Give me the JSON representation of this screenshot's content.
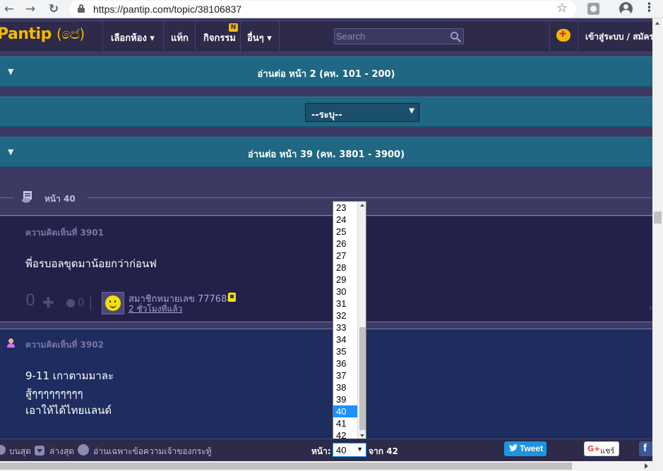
{
  "browser": {
    "url": "https://pantip.com/topic/38106837",
    "back_icon": "←",
    "forward_icon": "→",
    "reload_icon": "↻",
    "star_icon": "☆",
    "menu_icon": "⋮"
  },
  "header": {
    "logo": "Pantip",
    "logo_suffix": "(෧෪)",
    "menu": [
      {
        "label": "เลือกห้อง ▾"
      },
      {
        "label": "แท็ก"
      },
      {
        "label": "กิจกรรม"
      },
      {
        "label": "อื่นๆ ▾"
      }
    ],
    "new_badge": "N",
    "search_placeholder": "Search",
    "login_label": "เข้าสู่ระบบ / สมัคร"
  },
  "read_bars": {
    "arrow": "▼",
    "page2": "อ่านต่อ หน้า 2 (คห. 101 - 200)",
    "page39": "อ่านต่อ หน้า 39 (คห. 3801 - 3900)"
  },
  "filter_select": {
    "value": "--ระบุ--",
    "caret": "▼"
  },
  "page_divider": {
    "label": "หน้า 40"
  },
  "comment1": {
    "label": "ความคิดเห็นที่ 3901",
    "body": "พี่อรบอลขุดมาน้อยกว่าก่อนฟ",
    "votes": "0",
    "plus": "✚",
    "emotions": "0",
    "user_name": "สมาชิกหมายเลข 777688",
    "time": "2 ชั่วโมงที่แล้ว"
  },
  "comment2": {
    "label": "ความคิดเห็นที่ 3902",
    "lines": [
      "9-11 เกาตามมาละ",
      "สู้ๆๆๆๆๆๆๆๆๆ",
      "เอาให้ได้ไทยแลนด์"
    ]
  },
  "page_dropdown": {
    "options": [
      "23",
      "24",
      "25",
      "26",
      "27",
      "28",
      "29",
      "30",
      "31",
      "32",
      "33",
      "34",
      "35",
      "36",
      "37",
      "38",
      "39",
      "40",
      "41",
      "42"
    ],
    "selected": "40"
  },
  "bottom_bar": {
    "top_label": "บนสุด",
    "bottom_label": "ล่างสุด",
    "owner_label": "อ่านเฉพาะข้อความเจ้าของกระทู้",
    "page_label": "หน้า:",
    "page_value": "40",
    "page_caret": "▼",
    "of_label": "จาก 42",
    "tweet_label": "Tweet",
    "gplus_g": "G+",
    "share_label": "แชร์"
  },
  "colors": {
    "background": "#3c3963",
    "header": "#2d2a4a",
    "read_bar": "#1f6782",
    "logo": "#f5b900",
    "selected": "#1e90ff"
  }
}
